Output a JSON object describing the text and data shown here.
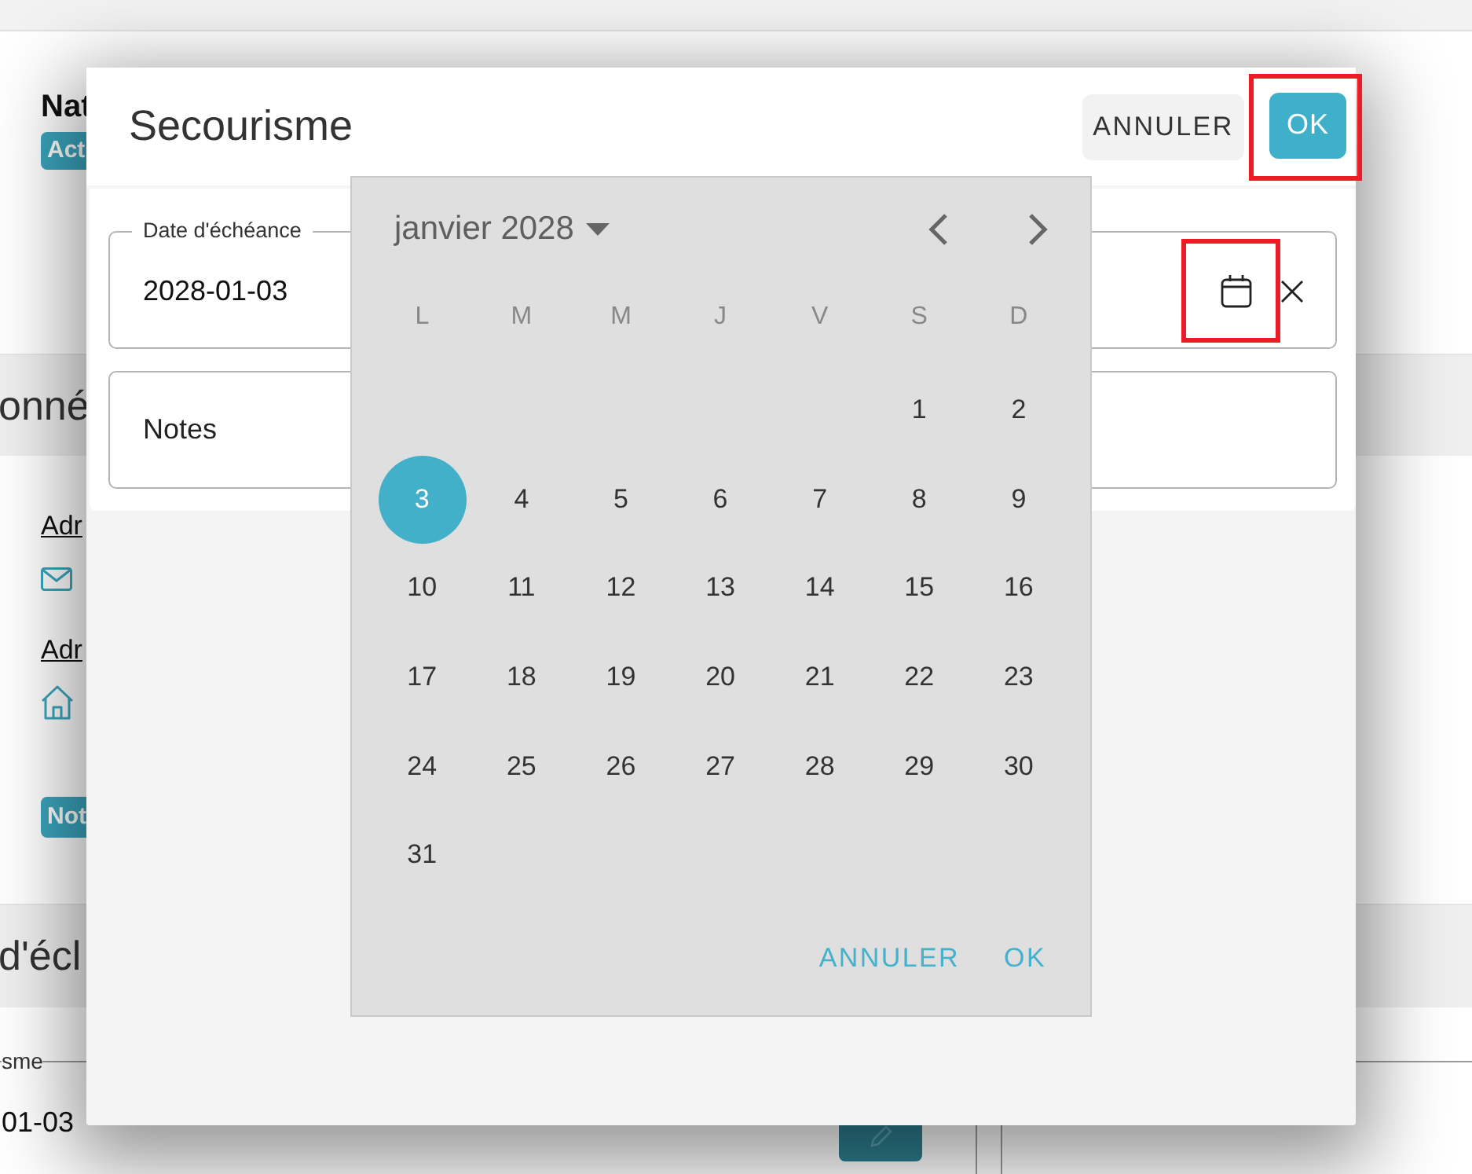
{
  "background_page": {
    "profile": {
      "name": "Nat",
      "badge": "Act"
    },
    "contact_section": {
      "title": "onné",
      "links": [
        {
          "label": "Adr",
          "kind": "email"
        },
        {
          "label": "Adr",
          "kind": "postal"
        }
      ],
      "badge": "Not"
    },
    "due_section": {
      "title": "d'écl",
      "field": {
        "label": "sme",
        "value": "01-03"
      }
    }
  },
  "dialog": {
    "title": "Secourisme",
    "buttons": [
      {
        "label": "ANNULER",
        "kind": "secondary",
        "highlighted": false
      },
      {
        "label": "OK",
        "kind": "primary",
        "highlighted": true
      }
    ],
    "date_field": {
      "label": "Date d'échéance",
      "value": "2028-01-03",
      "calendar_button_highlighted": true
    },
    "notes_field": {
      "label": "Notes"
    }
  },
  "date_picker": {
    "month": "janvier 2028",
    "weekdays": [
      "L",
      "M",
      "M",
      "J",
      "V",
      "S",
      "D"
    ],
    "weeks": [
      [
        {
          "day": "1",
          "selected": false
        },
        {
          "day": "2",
          "selected": false
        }
      ],
      [
        {
          "day": "3",
          "selected": true
        },
        {
          "day": "4",
          "selected": false
        },
        {
          "day": "5",
          "selected": false
        },
        {
          "day": "6",
          "selected": false
        },
        {
          "day": "7",
          "selected": false
        },
        {
          "day": "8",
          "selected": false
        },
        {
          "day": "9",
          "selected": false
        }
      ],
      [
        {
          "day": "10",
          "selected": false
        },
        {
          "day": "11",
          "selected": false
        },
        {
          "day": "12",
          "selected": false
        },
        {
          "day": "13",
          "selected": false
        },
        {
          "day": "14",
          "selected": false
        },
        {
          "day": "15",
          "selected": false
        },
        {
          "day": "16",
          "selected": false
        }
      ],
      [
        {
          "day": "17",
          "selected": false
        },
        {
          "day": "18",
          "selected": false
        },
        {
          "day": "19",
          "selected": false
        },
        {
          "day": "20",
          "selected": false
        },
        {
          "day": "21",
          "selected": false
        },
        {
          "day": "22",
          "selected": false
        },
        {
          "day": "23",
          "selected": false
        }
      ],
      [
        {
          "day": "24",
          "selected": false
        },
        {
          "day": "25",
          "selected": false
        },
        {
          "day": "26",
          "selected": false
        },
        {
          "day": "27",
          "selected": false
        },
        {
          "day": "28",
          "selected": false
        },
        {
          "day": "29",
          "selected": false
        },
        {
          "day": "30",
          "selected": false
        }
      ],
      [
        {
          "day": "31",
          "selected": false
        }
      ]
    ],
    "buttons": [
      "ANNULER",
      "OK"
    ]
  }
}
